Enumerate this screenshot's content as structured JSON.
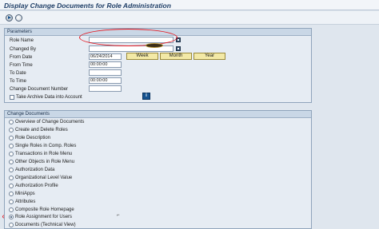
{
  "window": {
    "title": "Display Change Documents for Role Administration"
  },
  "parameters": {
    "header": "Parameters",
    "role_name": {
      "label": "Role Name",
      "value": ""
    },
    "changed_by": {
      "label": "Changed By",
      "value": ""
    },
    "from_date": {
      "label": "From Date",
      "value": "06/24/2014"
    },
    "from_time": {
      "label": "From Time",
      "value": "00:00:00"
    },
    "to_date": {
      "label": "To Date",
      "value": ""
    },
    "to_time": {
      "label": "To Time",
      "value": "00:00:00"
    },
    "change_doc_number": {
      "label": "Change Document Number",
      "value": ""
    },
    "archive": {
      "label": "Take Archive Data into Account",
      "checked": false
    },
    "period_buttons": {
      "week": "Week",
      "month": "Month",
      "year": "Year"
    },
    "info_button": "i"
  },
  "change_documents": {
    "header": "Change Documents",
    "options": [
      {
        "label": "Overview of Change Documents",
        "selected": false
      },
      {
        "label": "Create and Delete Roles",
        "selected": false
      },
      {
        "label": "Role Description",
        "selected": false
      },
      {
        "label": "Single Roles in Comp. Roles",
        "selected": false
      },
      {
        "label": "Transactions in Role Menu",
        "selected": false
      },
      {
        "label": "Other Objects in Role Menu",
        "selected": false
      },
      {
        "label": "Authorization Data",
        "selected": false
      },
      {
        "label": "Organizational Level Value",
        "selected": false
      },
      {
        "label": "Authorization Profile",
        "selected": false
      },
      {
        "label": "MiniApps",
        "selected": false
      },
      {
        "label": "Attributes",
        "selected": false
      },
      {
        "label": "Composite Role Homepage",
        "selected": false
      },
      {
        "label": "Role Assignment for Users",
        "selected": true
      },
      {
        "label": "Documents (Technical View)",
        "selected": false
      }
    ]
  },
  "colors": {
    "annotation": "#e4161f",
    "button_yellow": "#f3e9a6",
    "group_header": "#c9d7e6"
  }
}
